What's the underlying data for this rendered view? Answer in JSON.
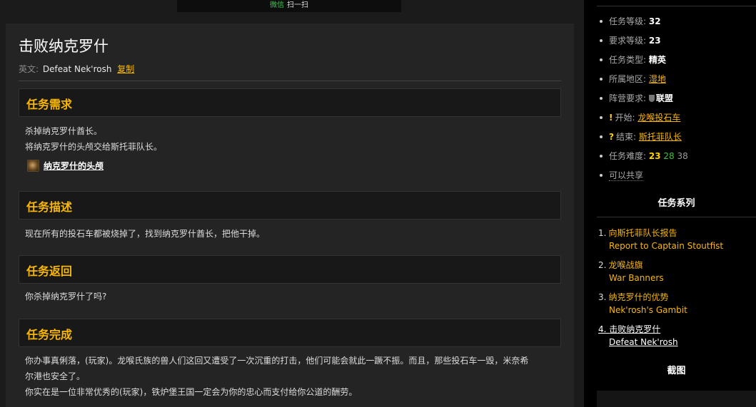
{
  "banner": {
    "wechat": "微信",
    "scan": "扫一扫"
  },
  "quest": {
    "title": "击败纳克罗什",
    "english_label": "英文:",
    "english_name": "Defeat Nek'rosh",
    "copy_label": "复制"
  },
  "sections": {
    "requirements": {
      "title": "任务需求",
      "lines": [
        "杀掉纳克罗什酋长。",
        "将纳克罗什的头颅交给斯托菲队长。"
      ],
      "item": "纳克罗什的头颅"
    },
    "description": {
      "title": "任务描述",
      "text": "现在所有的投石车都被烧掉了，找到纳克罗什酋长，把他干掉。"
    },
    "progress": {
      "title": "任务返回",
      "text": "你杀掉纳克罗什了吗?"
    },
    "completion": {
      "title": "任务完成",
      "lines": [
        "你办事真俐落，(玩家)。龙喉氏族的兽人们这回又遭受了一次沉重的打击，他们可能会就此一蹶不振。而且，那些投石车一毁，米奈希",
        "尔港也安全了。",
        "你实在是一位非常优秀的(玩家)，铁炉堡王国一定会为你的忠心而支付给你公道的酬劳。"
      ]
    }
  },
  "sidebar": {
    "info": {
      "level_label": "任务等级:",
      "level": "32",
      "req_label": "要求等级:",
      "req": "23",
      "type_label": "任务类型:",
      "type": "精英",
      "zone_label": "所属地区:",
      "zone": "湿地",
      "faction_label": "阵营要求:",
      "faction": "联盟",
      "start_label": "开始:",
      "start": "龙喉投石车",
      "end_label": "结束:",
      "end": "斯托菲队长",
      "diff_label": "任务难度:",
      "diff1": "23",
      "diff2": "28",
      "diff3": "38",
      "share": "可以共享"
    },
    "series_title": "任务系列",
    "series": [
      {
        "num": "1.",
        "cn": "向斯托菲队长报告",
        "en": "Report to Captain Stoutfist"
      },
      {
        "num": "2.",
        "cn": "龙喉战旗",
        "en": "War Banners"
      },
      {
        "num": "3.",
        "cn": "纳克罗什的优势",
        "en": "Nek'rosh's Gambit"
      },
      {
        "num": "4.",
        "cn": "击败纳克罗什",
        "en": "Defeat Nek'rosh"
      }
    ],
    "screenshot_title": "截图"
  },
  "colors": {
    "accent": "#f8b700",
    "background": "#1b1b1b",
    "panel": "#242424",
    "sidebar": "#000000"
  }
}
